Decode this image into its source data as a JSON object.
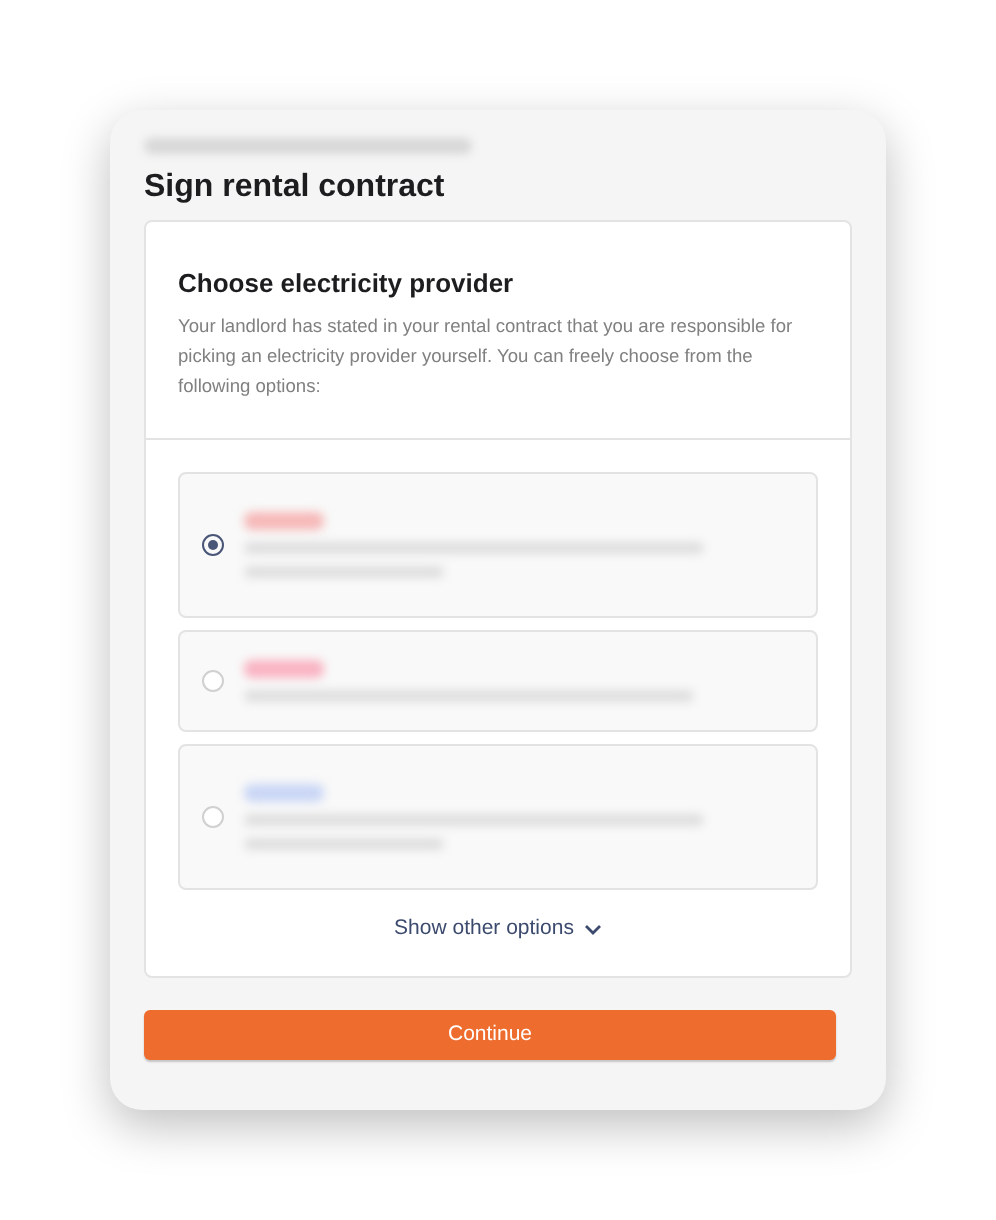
{
  "dialog": {
    "title": "Sign rental contract"
  },
  "section": {
    "heading": "Choose electricity provider",
    "description": "Your landlord has stated in your rental contract that you are responsible for picking an electricity provider yourself. You can freely choose from the following options:"
  },
  "options": [
    {
      "selected": true,
      "kind": "two-line",
      "color": "#f6b8b8"
    },
    {
      "selected": false,
      "kind": "one-line",
      "color": "#f9b3c2"
    },
    {
      "selected": false,
      "kind": "two-line",
      "color": "#c9d6f5"
    }
  ],
  "show_more": {
    "label": "Show other options",
    "expanded": false
  },
  "continue_button": {
    "label": "Continue"
  }
}
